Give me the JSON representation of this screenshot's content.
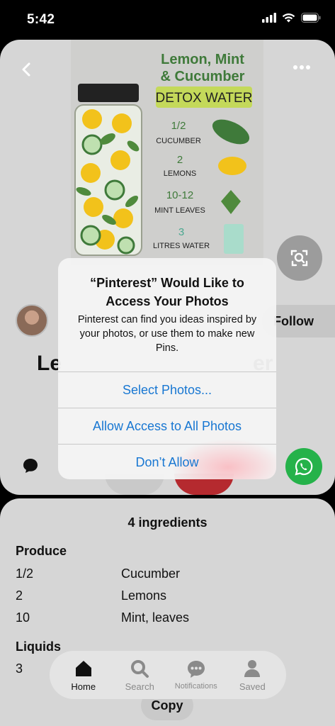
{
  "status_bar": {
    "time": "5:42"
  },
  "pin": {
    "infographic": {
      "title_line1": "Lemon, Mint",
      "title_line2": "& Cucumber",
      "title_line3": "DETOX WATER",
      "items": [
        {
          "qty": "1/2",
          "name": "CUCUMBER"
        },
        {
          "qty": "2",
          "name": "LEMONS"
        },
        {
          "qty": "10-12",
          "name": "MINT LEAVES"
        },
        {
          "qty": "3",
          "name": "LITRES WATER"
        }
      ]
    },
    "follow_label": "Follow",
    "title_start": "Le",
    "title_end": "er"
  },
  "ingredients": {
    "title": "4 ingredients",
    "sections": [
      {
        "label": "Produce",
        "items": [
          {
            "qty": "1/2",
            "name": "Cucumber"
          },
          {
            "qty": "2",
            "name": "Lemons"
          },
          {
            "qty": "10",
            "name": "Mint, leaves"
          }
        ]
      },
      {
        "label": "Liquids",
        "items": [
          {
            "qty": "3",
            "name": ""
          }
        ]
      }
    ]
  },
  "tab_bar": {
    "tabs": [
      {
        "label": "Home",
        "icon": "home-icon",
        "active": true
      },
      {
        "label": "Search",
        "icon": "search-icon",
        "active": false
      },
      {
        "label": "Notifications",
        "icon": "notifications-icon",
        "active": false
      },
      {
        "label": "Saved",
        "icon": "saved-icon",
        "active": false
      }
    ]
  },
  "copy_label": "Copy",
  "alert": {
    "title": "“Pinterest” Would Like to Access Your Photos",
    "message": "Pinterest can find you ideas inspired by your photos, or use them to make new Pins.",
    "buttons": [
      "Select Photos...",
      "Allow Access to All Photos",
      "Don’t Allow"
    ]
  },
  "colors": {
    "accent_blue": "#1877d2",
    "save_red": "#b52a2f",
    "whatsapp_green": "#25b24a"
  }
}
